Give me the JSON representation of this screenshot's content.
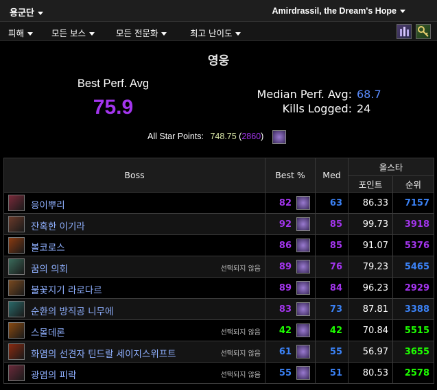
{
  "topbar": {
    "zone": "용군단",
    "raid": "Amirdrassil, the Dream's Hope"
  },
  "filters": [
    {
      "label": "피해"
    },
    {
      "label": "모든 보스"
    },
    {
      "label": "모든 전문화"
    },
    {
      "label": "최고 난이도"
    }
  ],
  "summary": {
    "difficulty": "영웅",
    "best_perf_label": "Best Perf. Avg",
    "best_perf_value": "75.9",
    "median_label": "Median Perf. Avg:",
    "median_value": "68.7",
    "kills_label": "Kills Logged:",
    "kills_value": "24",
    "all_star_label": "All Star Points:",
    "all_star_value": "748.75",
    "all_star_rank": "2860"
  },
  "table": {
    "headers": {
      "boss": "Boss",
      "best": "Best %",
      "med": "Med",
      "allstar": "올스타",
      "points": "포인트",
      "rank": "순위"
    },
    "not_selected": "선택되지 않음",
    "rows": [
      {
        "name": "응이뿌리",
        "best": "82",
        "med": "63",
        "points": "86.33",
        "rank": "7157",
        "not_selected": false,
        "best_color": "#a335ee",
        "med_color": "#3b82f6",
        "rank_color": "#3b82f6",
        "icon_color": "#7a2a3a"
      },
      {
        "name": "잔혹한 이기라",
        "best": "92",
        "med": "85",
        "points": "99.73",
        "rank": "3918",
        "not_selected": false,
        "best_color": "#a335ee",
        "med_color": "#a335ee",
        "rank_color": "#a335ee",
        "icon_color": "#6a3a2a"
      },
      {
        "name": "볼코로스",
        "best": "86",
        "med": "85",
        "points": "91.07",
        "rank": "5376",
        "not_selected": false,
        "best_color": "#a335ee",
        "med_color": "#a335ee",
        "rank_color": "#a335ee",
        "icon_color": "#8a3a10"
      },
      {
        "name": "꿈의 의회",
        "best": "89",
        "med": "76",
        "points": "79.23",
        "rank": "5465",
        "not_selected": true,
        "best_color": "#a335ee",
        "med_color": "#a335ee",
        "rank_color": "#3b82f6",
        "icon_color": "#3a6a5a"
      },
      {
        "name": "불꽃지기 라로다르",
        "best": "89",
        "med": "84",
        "points": "96.23",
        "rank": "2929",
        "not_selected": false,
        "best_color": "#a335ee",
        "med_color": "#a335ee",
        "rank_color": "#a335ee",
        "icon_color": "#7a4a20"
      },
      {
        "name": "순환의 방직공 니무에",
        "best": "83",
        "med": "73",
        "points": "87.81",
        "rank": "3388",
        "not_selected": false,
        "best_color": "#a335ee",
        "med_color": "#3b82f6",
        "rank_color": "#3b82f6",
        "icon_color": "#2a6a6a"
      },
      {
        "name": "스몰데론",
        "best": "42",
        "med": "42",
        "points": "70.84",
        "rank": "5515",
        "not_selected": true,
        "best_color": "#1eff00",
        "med_color": "#1eff00",
        "rank_color": "#1eff00",
        "icon_color": "#8a4a10"
      },
      {
        "name": "화염의 선견자 틴드랄 세이지스위프트",
        "best": "61",
        "med": "55",
        "points": "56.97",
        "rank": "3655",
        "not_selected": true,
        "best_color": "#3b82f6",
        "med_color": "#3b82f6",
        "rank_color": "#1eff00",
        "icon_color": "#8a2a10"
      },
      {
        "name": "광염의 피락",
        "best": "55",
        "med": "51",
        "points": "80.53",
        "rank": "2578",
        "not_selected": true,
        "best_color": "#3b82f6",
        "med_color": "#3b82f6",
        "rank_color": "#1eff00",
        "icon_color": "#6a2a3a"
      }
    ]
  },
  "colors": {
    "epic": "#a335ee",
    "rare": "#3b82f6",
    "uncommon": "#1eff00",
    "median_blue": "#5b8cff"
  }
}
